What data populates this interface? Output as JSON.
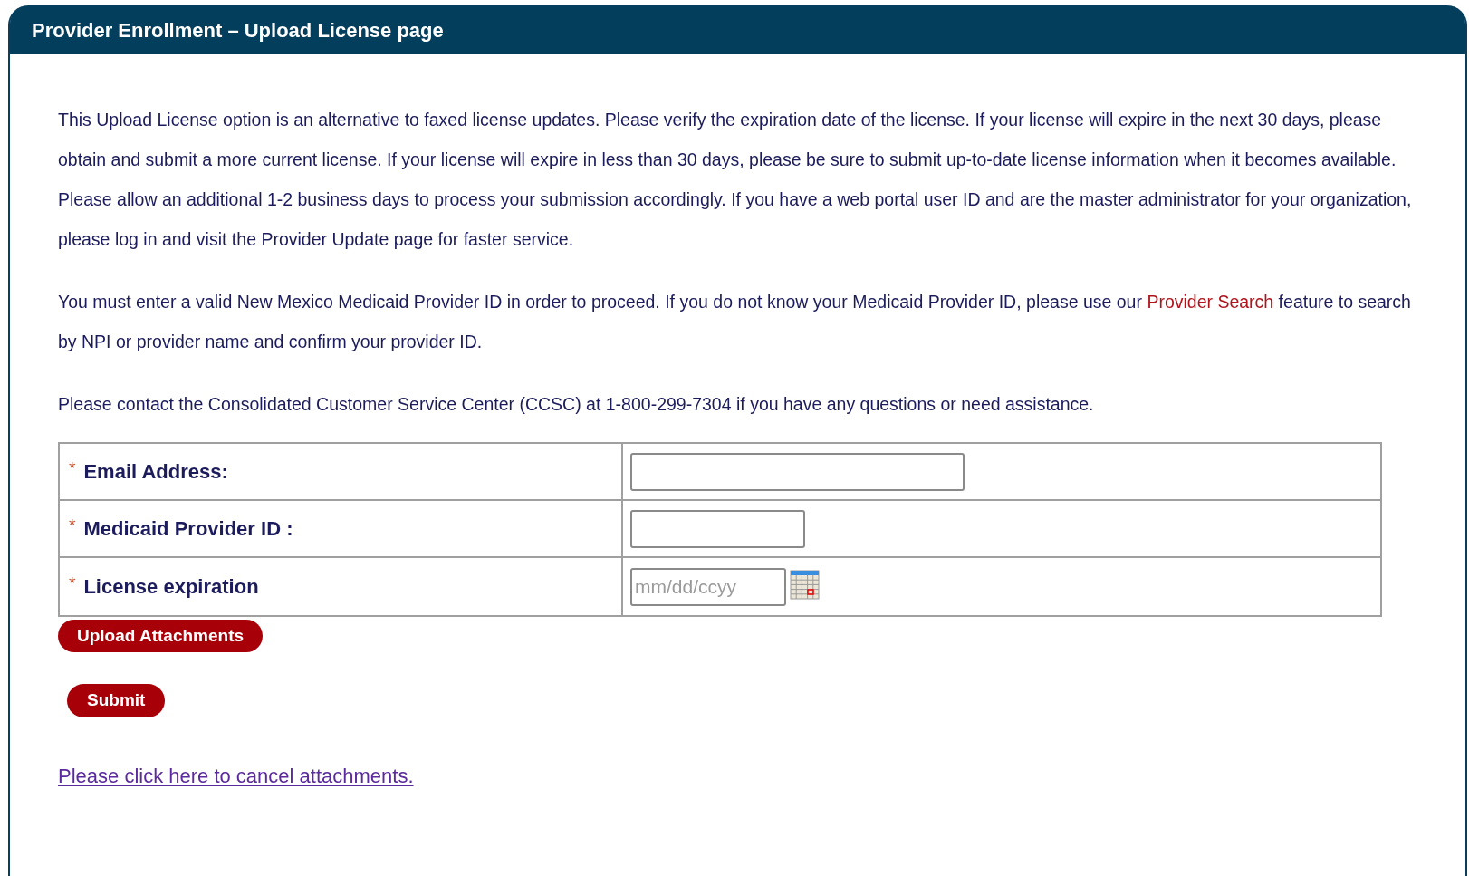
{
  "panel": {
    "title": "Provider Enrollment – Upload License page"
  },
  "paragraphs": [
    [
      {
        "kind": "text",
        "text": "This Upload License option is an alternative to faxed license updates. Please verify the expiration date of the license. If your license will expire in the next 30 days, please obtain and submit a more current license. If your license will expire in less than 30 days, please be sure to submit up-to-date license information when it becomes available. Please allow an additional 1-2 business days to process your submission accordingly. If you have a web portal user ID and are the master administrator for your organization, please log in and visit the Provider Update page for faster service."
      }
    ],
    [
      {
        "kind": "text",
        "text": "You must enter a valid New Mexico Medicaid Provider ID in order to proceed. If you do not know your Medicaid Provider ID, please use our "
      },
      {
        "kind": "link",
        "text": "Provider Search"
      },
      {
        "kind": "text",
        "text": " feature to search by NPI or provider name and confirm your provider ID."
      }
    ],
    [
      {
        "kind": "text",
        "text": "Please contact the Consolidated Customer Service Center (CCSC) at 1-800-299-7304 if you have any questions or need assistance."
      }
    ]
  ],
  "form": {
    "rows": [
      {
        "required_mark": "*",
        "label": "Email Address:",
        "kind": "email"
      },
      {
        "required_mark": "*",
        "label": "Medicaid Provider ID :",
        "kind": "id"
      },
      {
        "required_mark": "*",
        "label": "License expiration",
        "kind": "date",
        "placeholder": "mm/dd/ccyy"
      }
    ]
  },
  "buttons": [
    "Upload Attachments",
    "Submit"
  ],
  "cancel_link": "Please click here to cancel attachments."
}
